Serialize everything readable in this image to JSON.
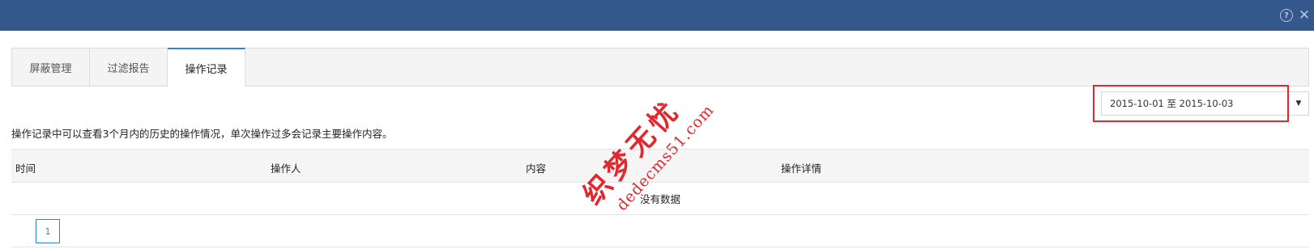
{
  "titlebar": {
    "help_icon": "?",
    "close_icon": "✕"
  },
  "tabs": [
    {
      "label": "屏蔽管理",
      "active": false
    },
    {
      "label": "过滤报告",
      "active": false
    },
    {
      "label": "操作记录",
      "active": true
    }
  ],
  "date_filter": {
    "value": "2015-10-01 至 2015-10-03",
    "caret": "▼"
  },
  "notice": "操作记录中可以查看3个月内的历史的操作情况，单次操作过多会记录主要操作内容。",
  "table": {
    "columns": [
      "时间",
      "操作人",
      "内容",
      "操作详情"
    ],
    "empty_text": "没有数据"
  },
  "pagination": {
    "current_page": "1"
  },
  "watermark": {
    "title": "织梦无忧",
    "url": "dedecms51.com",
    "color": "#e0292f"
  }
}
